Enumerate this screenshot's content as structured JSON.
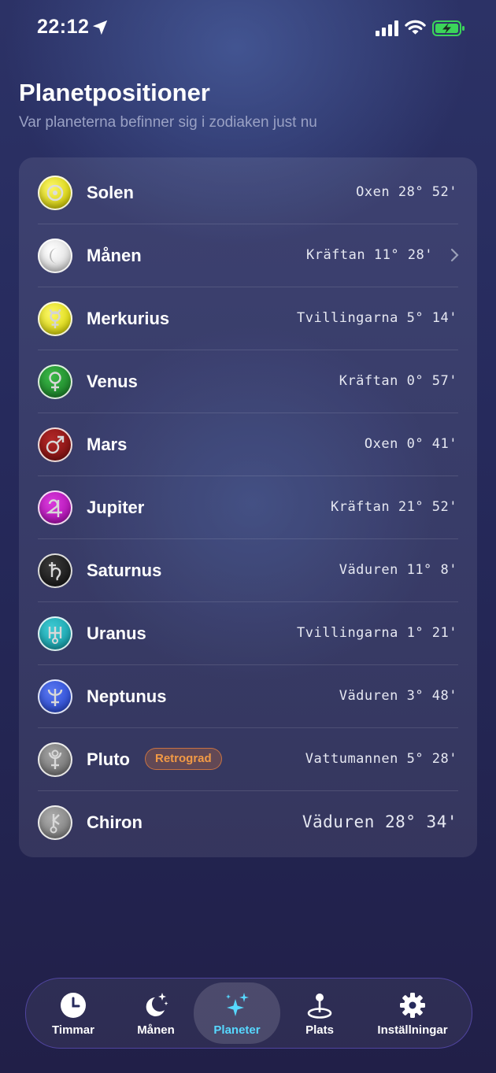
{
  "status": {
    "time": "22:12"
  },
  "header": {
    "title": "Planetpositioner",
    "subtitle": "Var planeterna befinner sig i zodiaken just nu"
  },
  "planets": [
    {
      "name": "Solen",
      "position": "Oxen 28° 52'"
    },
    {
      "name": "Månen",
      "position": "Kräftan 11° 28'"
    },
    {
      "name": "Merkurius",
      "position": "Tvillingarna 5° 14'"
    },
    {
      "name": "Venus",
      "position": "Kräftan 0° 57'"
    },
    {
      "name": "Mars",
      "position": "Oxen 0° 41'"
    },
    {
      "name": "Jupiter",
      "position": "Kräftan 21° 52'"
    },
    {
      "name": "Saturnus",
      "position": "Väduren 11° 8'"
    },
    {
      "name": "Uranus",
      "position": "Tvillingarna 1° 21'"
    },
    {
      "name": "Neptunus",
      "position": "Väduren 3° 48'"
    },
    {
      "name": "Pluto",
      "position": "Vattumannen 5° 28'",
      "badge": "Retrograd"
    },
    {
      "name": "Chiron",
      "position": "Väduren 28° 34'"
    }
  ],
  "tabs": [
    {
      "label": "Timmar",
      "icon": "clock-icon"
    },
    {
      "label": "Månen",
      "icon": "moon-stars-icon"
    },
    {
      "label": "Planeter",
      "icon": "sparkles-icon",
      "active": true
    },
    {
      "label": "Plats",
      "icon": "map-pin-icon"
    },
    {
      "label": "Inställningar",
      "icon": "gear-icon"
    }
  ],
  "colors": {
    "accent": "#57d8ff",
    "retrograde": "#f29a45",
    "solen": "#e8e21a",
    "manen": "#e9e9e9",
    "merkurius": "#e6e314",
    "venus": "#1f8a2c",
    "mars": "#8a1414",
    "jupiter": "#b514b8",
    "saturnus": "#1b1b1b",
    "uranus": "#1aa6b0",
    "neptunus": "#2f4fd6",
    "pluto": "#7a7a7a",
    "chiron": "#858585"
  }
}
